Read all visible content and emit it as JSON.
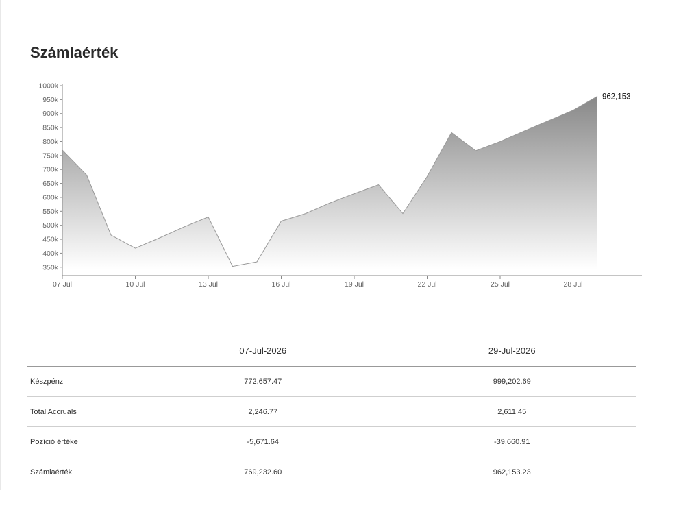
{
  "page": {
    "title": "Számlaérték"
  },
  "chart_data": {
    "type": "area",
    "title": "",
    "xlabel": "",
    "ylabel": "",
    "x_start_label": "07 Jul",
    "x_ticks": [
      "07 Jul",
      "10 Jul",
      "13 Jul",
      "16 Jul",
      "19 Jul",
      "22 Jul",
      "25 Jul",
      "28 Jul"
    ],
    "y_ticks": [
      "1000k",
      "950k",
      "900k",
      "850k",
      "800k",
      "750k",
      "700k",
      "650k",
      "600k",
      "550k",
      "500k",
      "450k",
      "400k",
      "350k"
    ],
    "ylim": [
      320000,
      1000000
    ],
    "xlim": [
      "07 Jul",
      "31 Jul"
    ],
    "grid": false,
    "colors": {
      "fill_top": "#888888",
      "fill_bottom": "#ffffff",
      "line": "#999999"
    },
    "series": [
      {
        "x": [
          "07 Jul",
          "08 Jul",
          "09 Jul",
          "10 Jul",
          "11 Jul",
          "12 Jul",
          "13 Jul",
          "14 Jul",
          "15 Jul",
          "16 Jul",
          "17 Jul",
          "18 Jul",
          "19 Jul",
          "20 Jul",
          "21 Jul",
          "22 Jul",
          "23 Jul",
          "24 Jul",
          "25 Jul",
          "26 Jul",
          "27 Jul",
          "28 Jul",
          "29 Jul"
        ],
        "values": [
          769233,
          680000,
          465000,
          418000,
          455000,
          494000,
          530000,
          353000,
          369000,
          515000,
          542000,
          580000,
          613000,
          645000,
          542000,
          675000,
          832000,
          767000,
          800000,
          838000,
          875000,
          912000,
          962153
        ]
      }
    ],
    "annotations": [
      {
        "x": "29 Jul",
        "y": 962153,
        "label": "962,153"
      }
    ]
  },
  "table": {
    "headers": [
      "",
      "07-Jul-2026",
      "29-Jul-2026"
    ],
    "rows": [
      {
        "label": "Készpénz",
        "start": "772,657.47",
        "end": "999,202.69"
      },
      {
        "label": "Total Accruals",
        "start": "2,246.77",
        "end": "2,611.45"
      },
      {
        "label": "Pozíció értéke",
        "start": "-5,671.64",
        "end": "-39,660.91"
      },
      {
        "label": "Számlaérték",
        "start": "769,232.60",
        "end": "962,153.23"
      }
    ]
  }
}
